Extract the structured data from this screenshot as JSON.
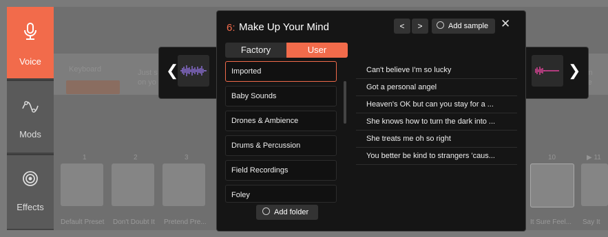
{
  "sidebar": {
    "items": [
      {
        "label": "Voice",
        "icon": "microphone-icon",
        "active": true
      },
      {
        "label": "Mods",
        "icon": "mod-curve-icon",
        "active": false
      },
      {
        "label": "Effects",
        "icon": "effects-icon",
        "active": false
      }
    ]
  },
  "background": {
    "keyboard_label": "Keyboard",
    "hint_line1": "Just s",
    "hint_line2": "on yo",
    "side_text": "ion",
    "side_text2": "re",
    "numbers": [
      "1",
      "2",
      "3",
      "10",
      "▶ 11"
    ],
    "tile_captions": [
      "Default Preset",
      "Don't Doubt It",
      "Pretend Pre...",
      "It Sure Feel...",
      "Say It"
    ]
  },
  "dialog": {
    "slot_number": "6:",
    "title": "Make Up Your Mind",
    "prev_label": "<",
    "next_label": ">",
    "add_sample_label": "Add sample",
    "close_label": "✕",
    "tabs": {
      "factory": "Factory",
      "user": "User"
    },
    "folders": [
      "Imported",
      "Baby Sounds",
      "Drones & Ambience",
      "Drums & Percussion",
      "Field Recordings",
      "Foley"
    ],
    "add_folder_label": "Add folder",
    "samples": [
      "Can't believe I'm so lucky",
      "Got a personal angel",
      "Heaven's OK but can you stay for a ...",
      "She knows how to turn the dark into ...",
      "She treats me oh so right",
      "You better be kind to strangers 'caus..."
    ]
  },
  "colors": {
    "accent": "#f26b4b",
    "waveform_left": "#8b6fd6",
    "waveform_right": "#e0439a"
  }
}
